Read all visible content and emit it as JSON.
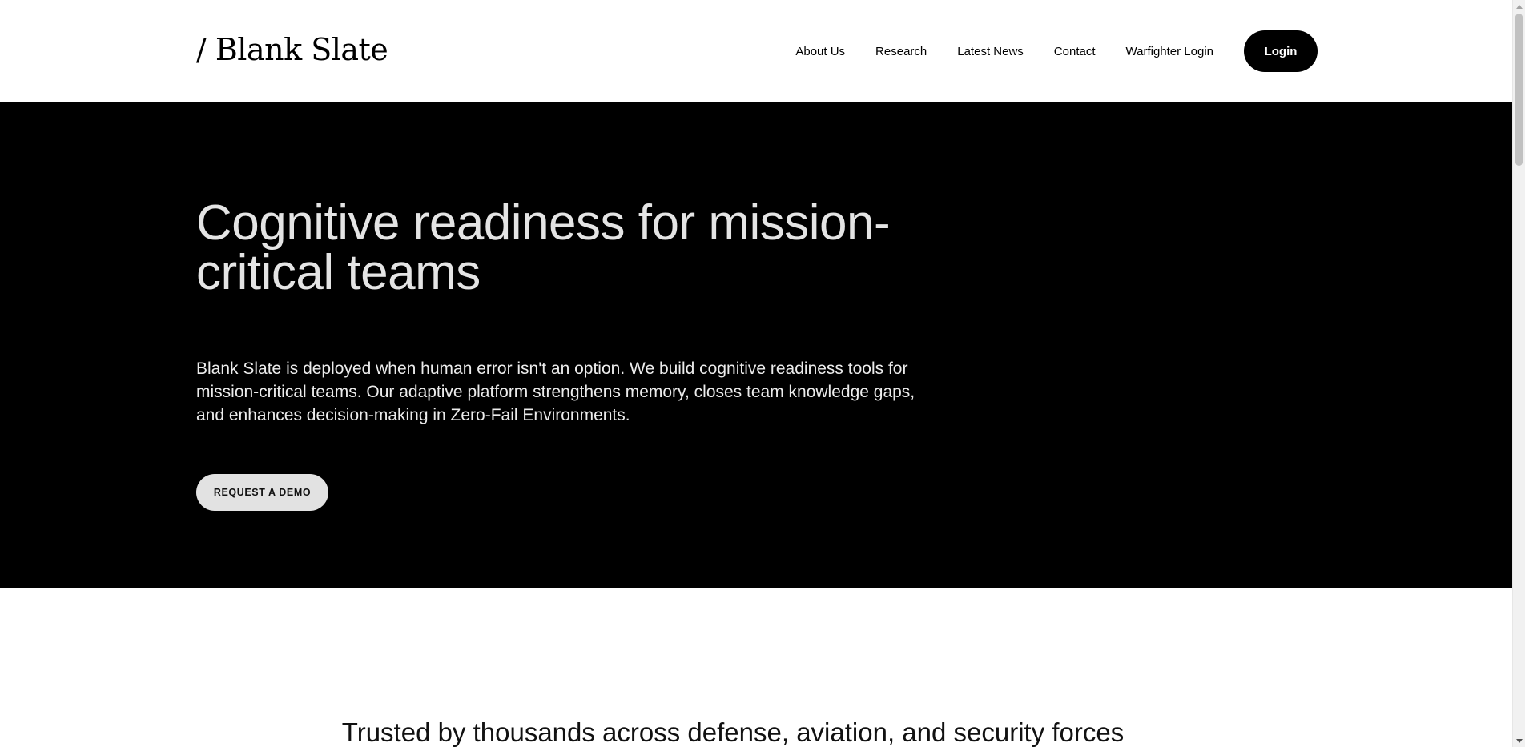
{
  "header": {
    "logo": "/ Blank Slate",
    "nav": [
      {
        "label": "About Us"
      },
      {
        "label": "Research"
      },
      {
        "label": "Latest News"
      },
      {
        "label": "Contact"
      },
      {
        "label": "Warfighter Login"
      }
    ],
    "login_label": "Login"
  },
  "hero": {
    "title": "Cognitive readiness for mission-critical teams",
    "description": "Blank Slate is deployed when human error isn't an option. We build cognitive readiness tools for mission-critical teams. Our adaptive platform strengthens memory, closes team knowledge gaps, and enhances decision-making in Zero-Fail Environments.",
    "cta_label": "REQUEST A DEMO"
  },
  "trusted": {
    "heading": "Trusted by thousands across defense, aviation, and security forces"
  },
  "colors": {
    "hero_bg": "#000000",
    "accent_button": "#000000",
    "cta_bg": "#e2e2e2"
  },
  "icons": {
    "scroll_up": "scroll-up-arrow-icon",
    "scroll_down": "scroll-down-arrow-icon"
  }
}
